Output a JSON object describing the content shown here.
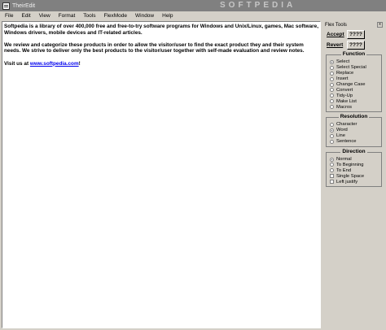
{
  "window": {
    "title": "TheirEdit",
    "watermark": "SOFTPEDIA"
  },
  "menu": [
    "File",
    "Edit",
    "View",
    "Format",
    "Tools",
    "FlexMode",
    "Window",
    "Help"
  ],
  "editor": {
    "para1": "Softpedia is a library of over 400,000 free and free-to-try software programs for Windows and Unix/Linux, games, Mac software, Windows drivers, mobile devices and IT-related articles.",
    "para2": "We review and categorize these products in order to allow the visitor/user to find the exact product they and their system needs. We strive to deliver only the best products to the visitor/user together with self-made evaluation and review notes.",
    "visit_prefix": "Visit us at ",
    "link": "www.softpedia.com",
    "visit_suffix": "!"
  },
  "panel": {
    "title": "Flex Tools",
    "close": "x",
    "accept_label": "Accept",
    "accept_value": "????",
    "revert_label": "Revert",
    "revert_value": "????",
    "function": {
      "title": "Function",
      "options": [
        "Select",
        "Select Special",
        "Replace",
        "Insert",
        "Change Case",
        "Convert",
        "Tidy-Up",
        "Make List",
        "Macros"
      ]
    },
    "resolution": {
      "title": "Resolution",
      "options": [
        "Character",
        "Word",
        "Line",
        "Sentence"
      ]
    },
    "direction": {
      "title": "Direction",
      "options": [
        "Normal",
        "To Beginning",
        "To End"
      ],
      "checks": [
        "Single Space",
        "Left justify"
      ]
    }
  }
}
